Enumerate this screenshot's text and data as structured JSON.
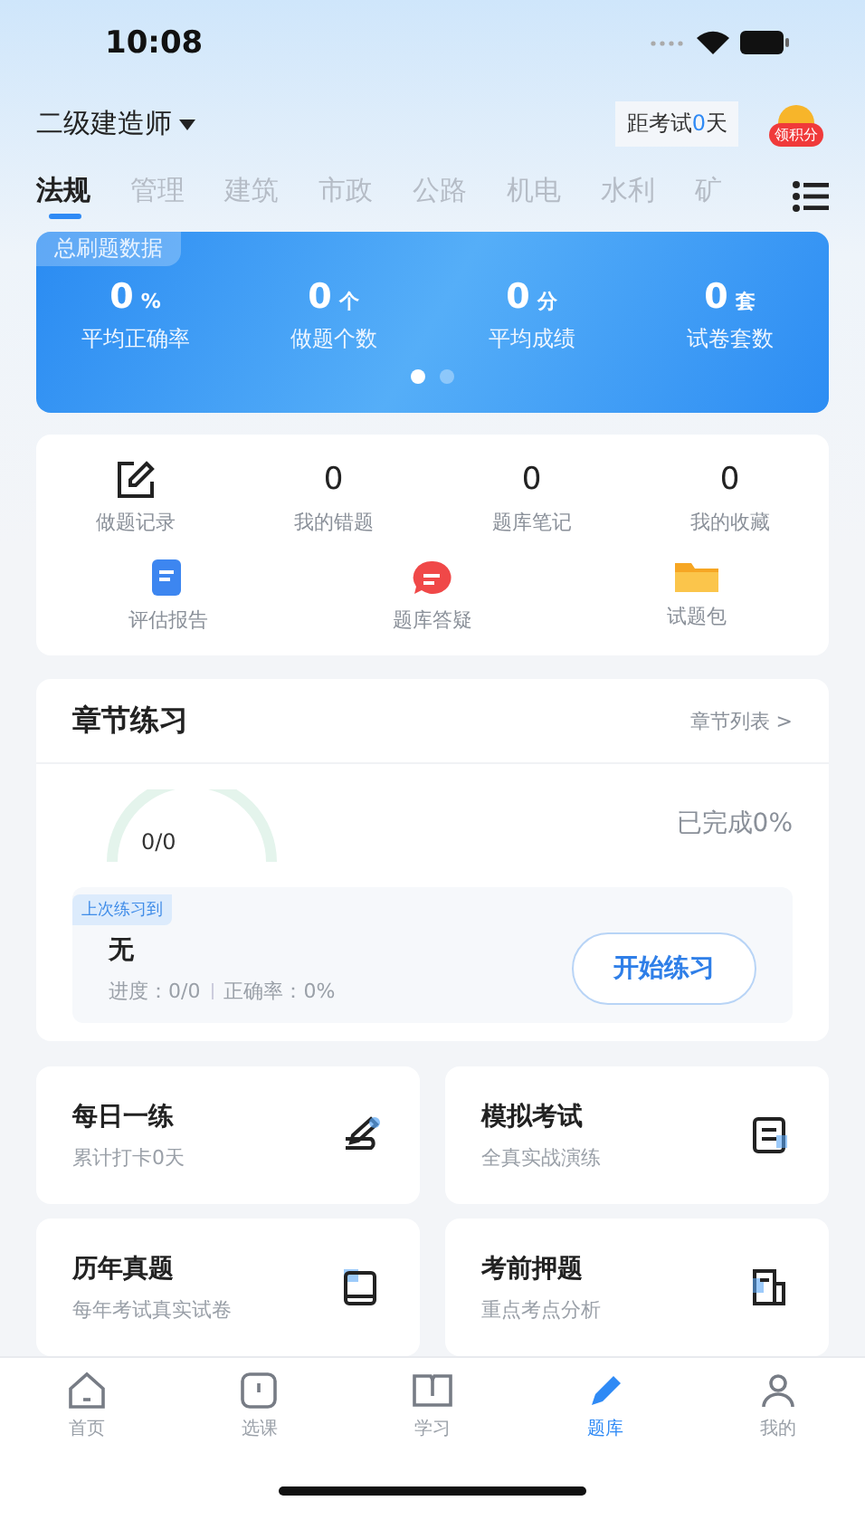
{
  "status_bar": {
    "time": "10:08"
  },
  "header": {
    "exam": "二级建造师",
    "countdown_prefix": "距考试",
    "countdown_days": "0",
    "countdown_suffix": "天",
    "points_badge": "领积分"
  },
  "tabs": [
    {
      "label": "法规",
      "selected": true
    },
    {
      "label": "管理",
      "selected": false
    },
    {
      "label": "建筑",
      "selected": false
    },
    {
      "label": "市政",
      "selected": false
    },
    {
      "label": "公路",
      "selected": false
    },
    {
      "label": "机电",
      "selected": false
    },
    {
      "label": "水利",
      "selected": false
    },
    {
      "label": "矿",
      "selected": false
    }
  ],
  "summary": {
    "title": "总刷题数据",
    "stats": [
      {
        "value": "0",
        "unit": "%",
        "label": "平均正确率"
      },
      {
        "value": "0",
        "unit": "个",
        "label": "做题个数"
      },
      {
        "value": "0",
        "unit": "分",
        "label": "平均成绩"
      },
      {
        "value": "0",
        "unit": "套",
        "label": "试卷套数"
      }
    ],
    "pages": [
      {
        "selected": true
      },
      {
        "selected": false
      }
    ]
  },
  "shortcuts": [
    {
      "kind": "icon",
      "label": "做题记录"
    },
    {
      "kind": "count",
      "value": "0",
      "label": "我的错题"
    },
    {
      "kind": "count",
      "value": "0",
      "label": "题库笔记"
    },
    {
      "kind": "count",
      "value": "0",
      "label": "我的收藏"
    }
  ],
  "tools": [
    {
      "label": "评估报告"
    },
    {
      "label": "题库答疑"
    },
    {
      "label": "试题包"
    }
  ],
  "chapter": {
    "title": "章节练习",
    "link": "章节列表 >",
    "gauge_text": "0/0",
    "completed": "已完成0%",
    "last_tag": "上次练习到",
    "last_name": "无",
    "progress": "进度：0/0",
    "accuracy": "正确率：0%",
    "button": "开始练习"
  },
  "cards": [
    {
      "title": "每日一练",
      "subtitle": "累计打卡0天"
    },
    {
      "title": "模拟考试",
      "subtitle": "全真实战演练"
    },
    {
      "title": "历年真题",
      "subtitle": "每年考试真实试卷"
    },
    {
      "title": "考前押题",
      "subtitle": "重点考点分析"
    }
  ],
  "nav": [
    {
      "label": "首页",
      "selected": false
    },
    {
      "label": "选课",
      "selected": false
    },
    {
      "label": "学习",
      "selected": false
    },
    {
      "label": "题库",
      "selected": true
    },
    {
      "label": "我的",
      "selected": false
    }
  ]
}
